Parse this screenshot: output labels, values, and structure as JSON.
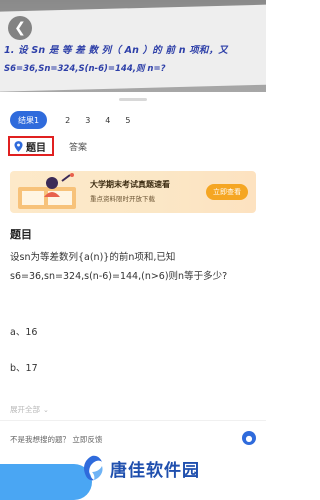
{
  "photo": {
    "line1": "1. 设 Sn 是 等 差 数 列（ An ）的 前 n 项和，又",
    "line2": "S6=36,Sn=324,S(n-6)=144,则 n=?"
  },
  "result_tabs": [
    "结果1",
    "2",
    "3",
    "4",
    "5"
  ],
  "sub_tabs": {
    "active": "题目",
    "other": "答案"
  },
  "banner": {
    "title": "大学期末考试真题速看",
    "subtitle": "重点资料限时开放下载",
    "button": "立即查看"
  },
  "section_title": "题目",
  "question": "设sn为等差数列{a(n)}的前n项和,已知s6=36,sn=324,s(n-6)=144,(n>6)则n等于多少?",
  "options": {
    "a": "a、16",
    "b": "b、17"
  },
  "expand_label": "展开全部",
  "feedback": {
    "question": "不是我想搜的题？",
    "link": "立即反馈"
  },
  "watermark": "唐佳软件园",
  "colors": {
    "accent": "#2f6bdc",
    "highlight_border": "#e02020",
    "banner_button": "#f5a623"
  }
}
